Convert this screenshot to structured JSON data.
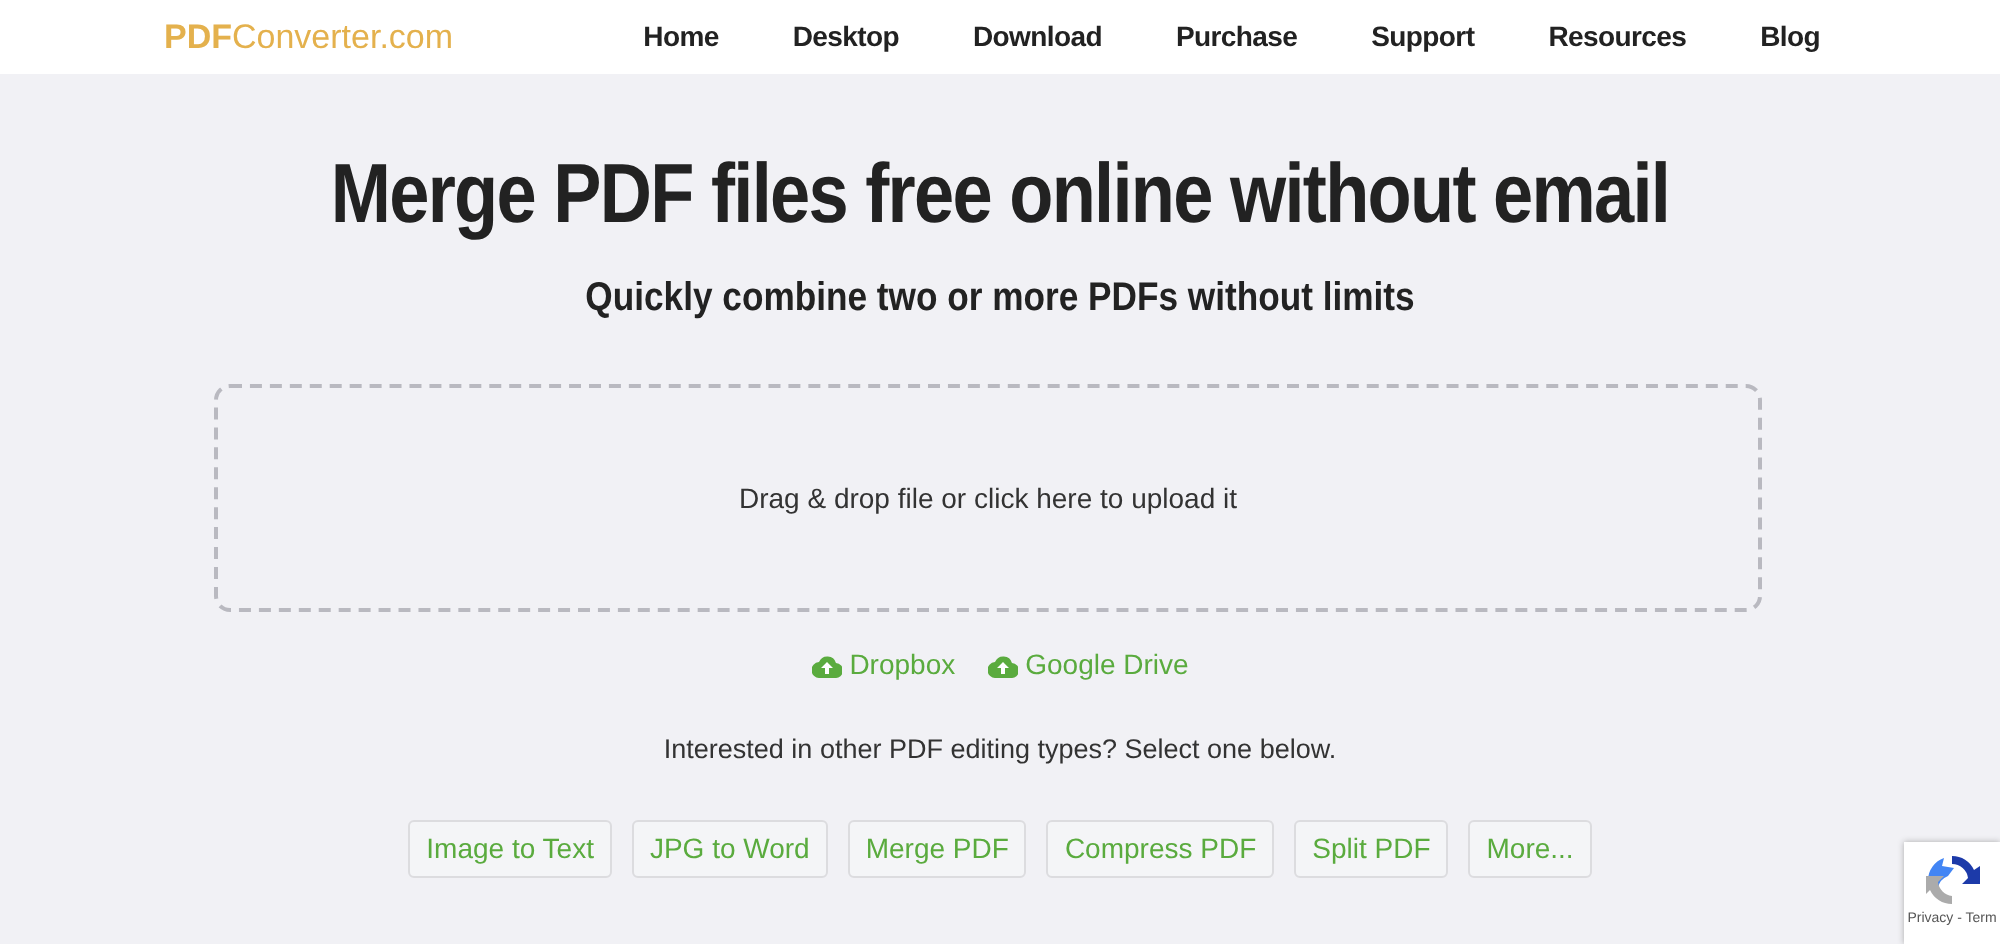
{
  "logo": "**PDF**Converter.com",
  "nav": [
    {
      "label": "Home"
    },
    {
      "label": "Desktop"
    },
    {
      "label": "Download"
    },
    {
      "label": "Purchase"
    },
    {
      "label": "Support"
    },
    {
      "label": "Resources"
    },
    {
      "label": "Blog"
    }
  ],
  "heading": "Merge PDF files free online without email",
  "subheading": "Quickly combine two or more PDFs without limits",
  "dropzone": {
    "text": "Drag & drop file or click here to upload it"
  },
  "cloud_sources": [
    {
      "label": "Dropbox"
    },
    {
      "label": "Google Drive"
    }
  ],
  "prompt": "Interested in other PDF editing types? Select one below.",
  "tools": [
    {
      "label": "Image to Text"
    },
    {
      "label": "JPG to Word"
    },
    {
      "label": "Merge PDF"
    },
    {
      "label": "Compress PDF"
    },
    {
      "label": "Split PDF"
    },
    {
      "label": "More..."
    }
  ],
  "recaptcha": {
    "text": "Privacy - Term"
  }
}
